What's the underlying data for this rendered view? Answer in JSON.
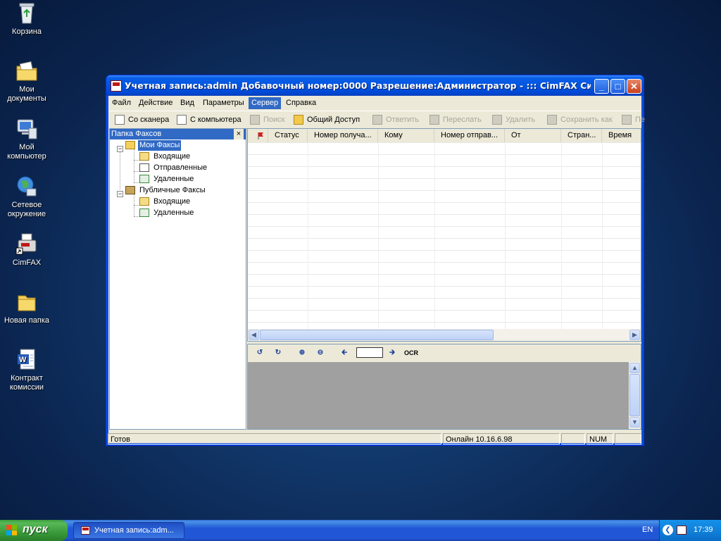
{
  "desktop": {
    "icons": [
      {
        "label": "Корзина"
      },
      {
        "label": "Мои документы"
      },
      {
        "label": "Мой компьютер"
      },
      {
        "label": "Сетевое окружение"
      },
      {
        "label": "CimFAX"
      },
      {
        "label": "Новая папка"
      },
      {
        "label": "Контракт комиссии"
      }
    ]
  },
  "window": {
    "title": "Учетная запись:admin  Добавочный номер:0000  Разрешение:Администратор - ::: CimFAX Система А...",
    "controls": {
      "minimize": "_",
      "maximize": "□",
      "close": "✕"
    }
  },
  "menu": {
    "items": [
      "Файл",
      "Действие",
      "Вид",
      "Параметры",
      "Сервер",
      "Справка"
    ],
    "active": "Сервер"
  },
  "toolbar": {
    "buttons": [
      {
        "label": "Со сканера",
        "enabled": true
      },
      {
        "label": "С компьютера",
        "enabled": true
      },
      {
        "label": "Поиск",
        "enabled": false
      },
      {
        "label": "Общий Доступ",
        "enabled": true
      },
      {
        "label": "Ответить",
        "enabled": false
      },
      {
        "label": "Переслать",
        "enabled": false
      },
      {
        "label": "Удалить",
        "enabled": false
      },
      {
        "label": "Сохранить как",
        "enabled": false
      },
      {
        "label": "Пе",
        "enabled": false
      }
    ]
  },
  "tree": {
    "header": "Папка Факсов",
    "close": "×",
    "my_faxes": "Мои Факсы",
    "my_inbox": "Входящие",
    "my_sent": "Отправленные",
    "my_deleted": "Удаленные",
    "public_faxes": "Публичные Факсы",
    "public_inbox": "Входящие",
    "public_deleted": "Удаленные"
  },
  "list": {
    "columns": [
      "Статус",
      "Номер получа...",
      "Кому",
      "Номер отправ...",
      "От",
      "Стран...",
      "Время"
    ],
    "rows": []
  },
  "viewer": {
    "ocr_label": "OCR",
    "page_value": ""
  },
  "status": {
    "ready": "Готов",
    "connection": "Онлайн 10.16.6.98",
    "num": "NUM"
  },
  "taskbar": {
    "start": "пуск",
    "task": "Учетная запись:adm...",
    "lang": "EN",
    "clock": "17:39"
  },
  "colors": {
    "titlebar": "#0254e0",
    "selection": "#316ac5",
    "taskbar": "#2157d7",
    "start_button": "#3a9a3a"
  }
}
